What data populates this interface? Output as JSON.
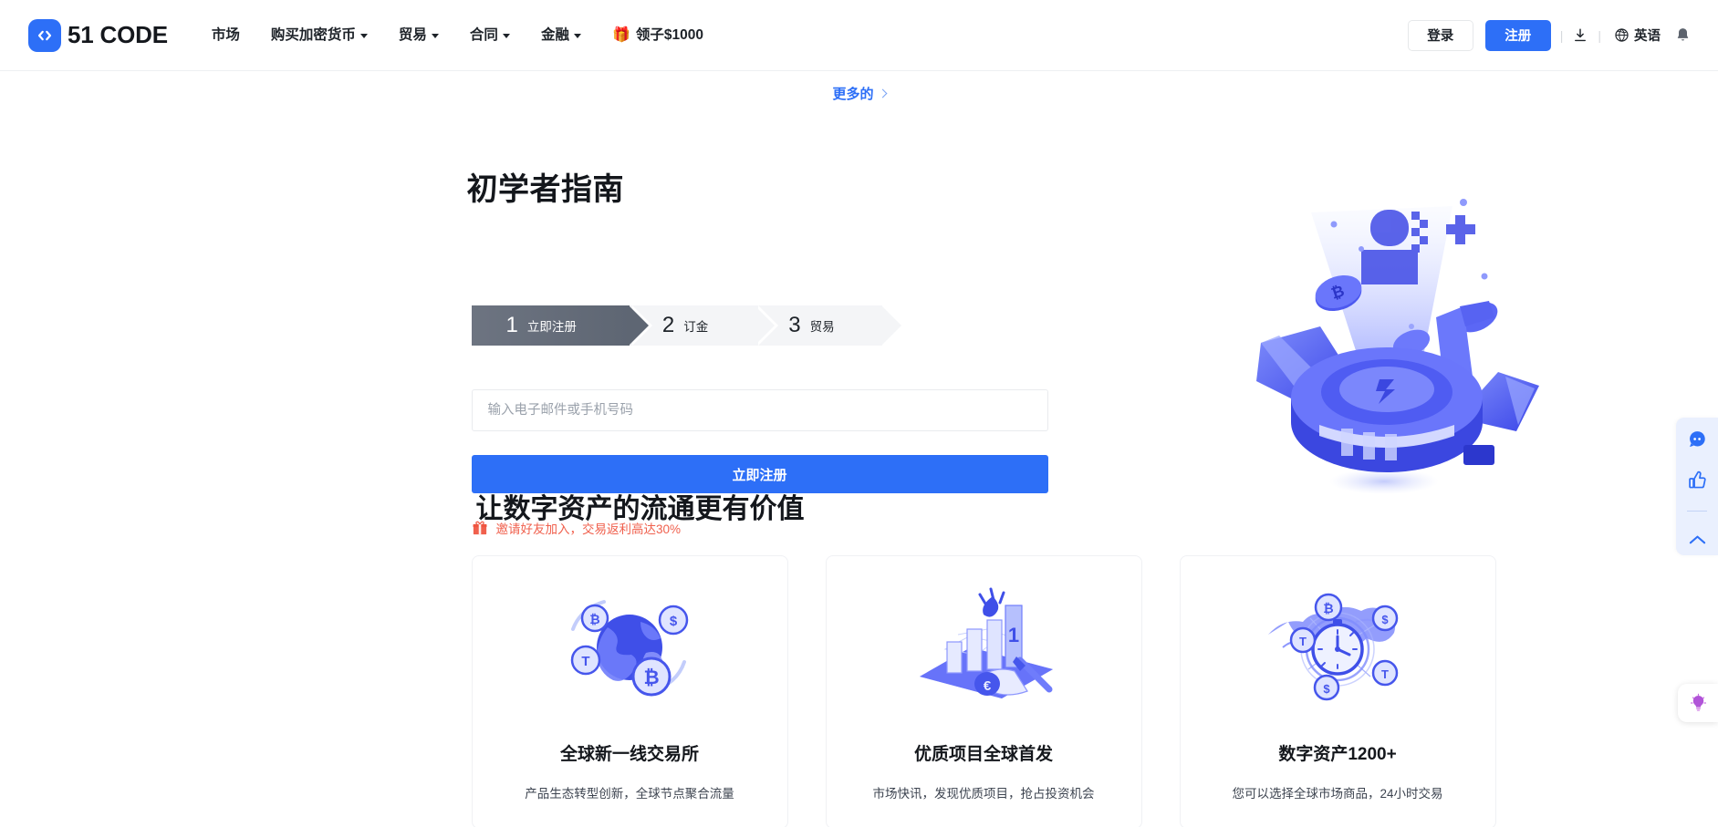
{
  "header": {
    "logo_text": "51 CODE",
    "logo_icon": "code-brackets-icon",
    "nav": [
      {
        "label": "市场",
        "has_caret": false
      },
      {
        "label": "购买加密货币",
        "has_caret": true
      },
      {
        "label": "贸易",
        "has_caret": true
      },
      {
        "label": "合同",
        "has_caret": true
      },
      {
        "label": "金融",
        "has_caret": true
      }
    ],
    "promo": {
      "icon": "gift-icon",
      "label": "领子$1000"
    },
    "login_label": "登录",
    "register_label": "注册",
    "download_icon": "download-icon",
    "language": {
      "icon": "globe-icon",
      "label": "英语"
    },
    "notification_icon": "bell-icon"
  },
  "hero": {
    "more_label": "更多的",
    "more_icon": "chevron-right-icon",
    "title": "初学者指南",
    "steps": [
      {
        "num": "1",
        "label": "立即注册",
        "active": true
      },
      {
        "num": "2",
        "label": "订金",
        "active": false
      },
      {
        "num": "3",
        "label": "贸易",
        "active": false
      }
    ],
    "input_placeholder": "输入电子邮件或手机号码",
    "input_value": "",
    "submit_label": "立即注册",
    "referral": {
      "icon": "gift-box-icon",
      "text": "邀请好友加入，交易返利高达30%"
    },
    "illustration": "robot-arms-crypto-icon"
  },
  "features": {
    "heading": "让数字资产的流通更有价值",
    "cards": [
      {
        "illustration": "globe-coins-icon",
        "title": "全球新一线交易所",
        "desc": "产品生态转型创新，全球节点聚合流量"
      },
      {
        "illustration": "bar-chart-flame-icon",
        "title": "优质项目全球首发",
        "desc": "市场快讯，发现优质项目，抢占投资机会"
      },
      {
        "illustration": "world-clock-coins-icon",
        "title": "数字资产1200+",
        "desc": "您可以选择全球市场商品，24小时交易"
      }
    ]
  },
  "side_dock": {
    "items": [
      {
        "icon": "customer-service-icon"
      },
      {
        "icon": "thumbs-up-icon"
      },
      {
        "icon": "scroll-to-top-icon"
      }
    ],
    "bulb": {
      "icon": "idea-bulb-icon"
    }
  },
  "colors": {
    "brand_blue": "#2d6ff7",
    "step_active_gray": "#5e6673",
    "referral_orange": "#f0604d",
    "text_dark": "#14171c"
  }
}
